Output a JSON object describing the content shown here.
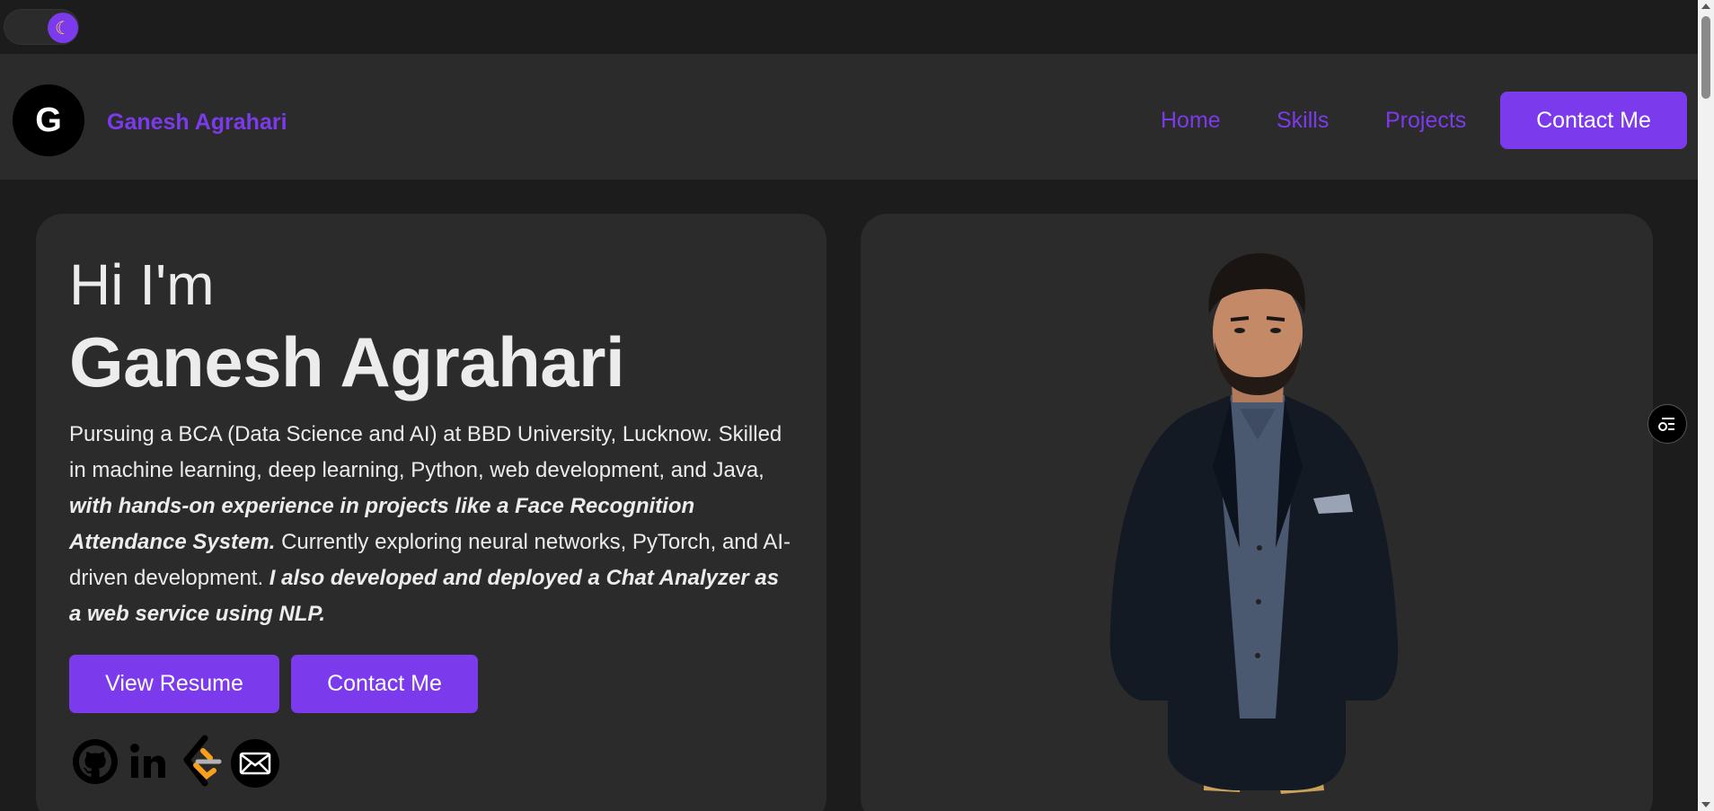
{
  "theme_toggle": {
    "icon": "moon-icon",
    "glyph": "☾"
  },
  "header": {
    "avatar_letter": "G",
    "brand": "Ganesh Agrahari",
    "nav": {
      "home": "Home",
      "skills": "Skills",
      "projects": "Projects",
      "contact": "Contact Me"
    }
  },
  "hero": {
    "greeting": "Hi I'm",
    "name": "Ganesh Agrahari",
    "bio": {
      "part1": "Pursuing a BCA (Data Science and AI) at BBD University, Lucknow. Skilled in machine learning, deep learning, Python, web development, and Java, ",
      "emph1": "with hands-on experience in projects like a Face Recognition Attendance System.",
      "part2": " Currently exploring neural networks, PyTorch, and AI-driven development. ",
      "emph2": "I also developed and deployed a Chat Analyzer as a web service using NLP."
    },
    "buttons": {
      "resume": "View Resume",
      "contact": "Contact Me"
    },
    "socials": [
      "github-icon",
      "linkedin-icon",
      "leetcode-icon",
      "email-icon"
    ]
  },
  "colors": {
    "accent": "#7c3aed",
    "background": "#1c1c1c",
    "card": "#2b2b2b"
  }
}
